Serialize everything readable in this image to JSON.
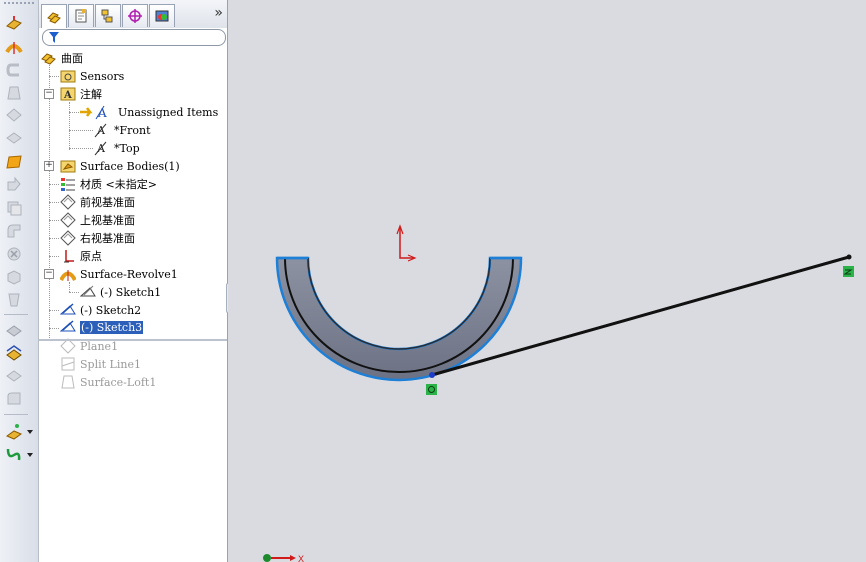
{
  "panel": {
    "tabs": [
      {
        "name": "feature-manager",
        "icon": "feature-tree-icon"
      },
      {
        "name": "property-manager",
        "icon": "property-manager-icon"
      },
      {
        "name": "configuration-manager",
        "icon": "configuration-icon"
      },
      {
        "name": "dimxpert-manager",
        "icon": "dimxpert-icon"
      },
      {
        "name": "display-manager",
        "icon": "display-manager-icon"
      }
    ],
    "more_tabs": "»",
    "filter_placeholder": ""
  },
  "tree": {
    "root": "曲面",
    "sensors": "Sensors",
    "annotations": "注解",
    "unassigned": "Unassigned Items",
    "front": "*Front",
    "top": "*Top",
    "surface_bodies": "Surface Bodies(1)",
    "material": "材质 <未指定>",
    "front_plane": "前视基准面",
    "top_plane": "上视基准面",
    "right_plane": "右视基准面",
    "origin": "原点",
    "revolve": "Surface-Revolve1",
    "sketch1": "(-) Sketch1",
    "sketch2": "(-) Sketch2",
    "sketch3": "(-) Sketch3",
    "plane1": "Plane1",
    "split_line": "Split Line1",
    "loft": "Surface-Loft1"
  },
  "viewport": {
    "triad_x_label": "X",
    "colors": {
      "surface": "#7f8596",
      "edge_highlight": "#1e7fd6",
      "origin": "#d11a1a",
      "relation_marker": "#2bb34a"
    }
  }
}
